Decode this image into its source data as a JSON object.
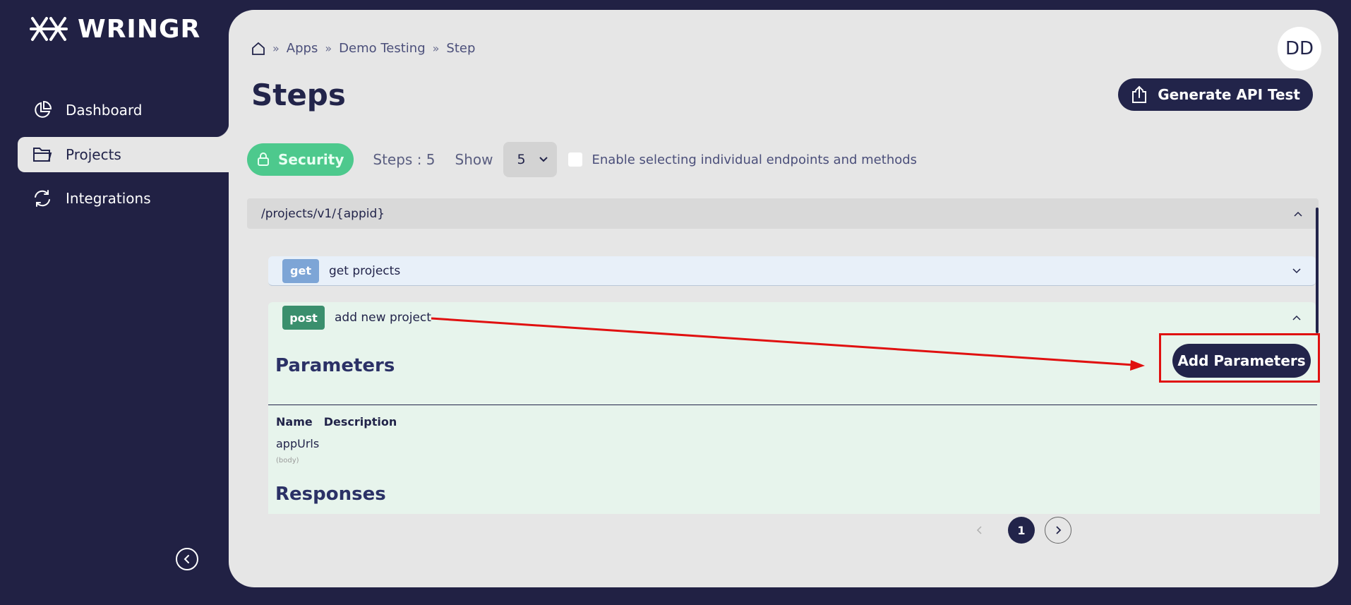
{
  "brand": {
    "name": "WRINGR"
  },
  "sidebar": {
    "items": [
      {
        "label": "Dashboard",
        "icon": "pie-chart-icon"
      },
      {
        "label": "Projects",
        "icon": "folder-icon"
      },
      {
        "label": "Integrations",
        "icon": "refresh-icon"
      }
    ]
  },
  "breadcrumb": {
    "items": [
      "Apps",
      "Demo Testing",
      "Step"
    ]
  },
  "user": {
    "initials": "DD"
  },
  "page": {
    "title": "Steps"
  },
  "actions": {
    "generate_label": "Generate API Test"
  },
  "toolbar": {
    "security_label": "Security",
    "steps_label": "Steps : 5",
    "show_label": "Show",
    "show_value": "5",
    "checkbox_label": "Enable selecting individual endpoints and methods"
  },
  "endpoint": {
    "path": "/projects/v1/{appid}",
    "operations": [
      {
        "method": "get",
        "summary": "get projects"
      },
      {
        "method": "post",
        "summary": "add new project"
      }
    ]
  },
  "parameters": {
    "title": "Parameters",
    "add_label": "Add Parameters",
    "col_name": "Name",
    "col_description": "Description",
    "rows": [
      {
        "name": "appUrls",
        "in": "(body)"
      }
    ]
  },
  "responses": {
    "title": "Responses"
  },
  "pagination": {
    "current": "1"
  },
  "colors": {
    "sidebar_bg": "#212144",
    "panel_bg": "#e6e6e6",
    "accent_green": "#4dc98d",
    "get_badge": "#7da5d6",
    "post_badge": "#3a8f6d",
    "annotation_red": "#e01010"
  }
}
